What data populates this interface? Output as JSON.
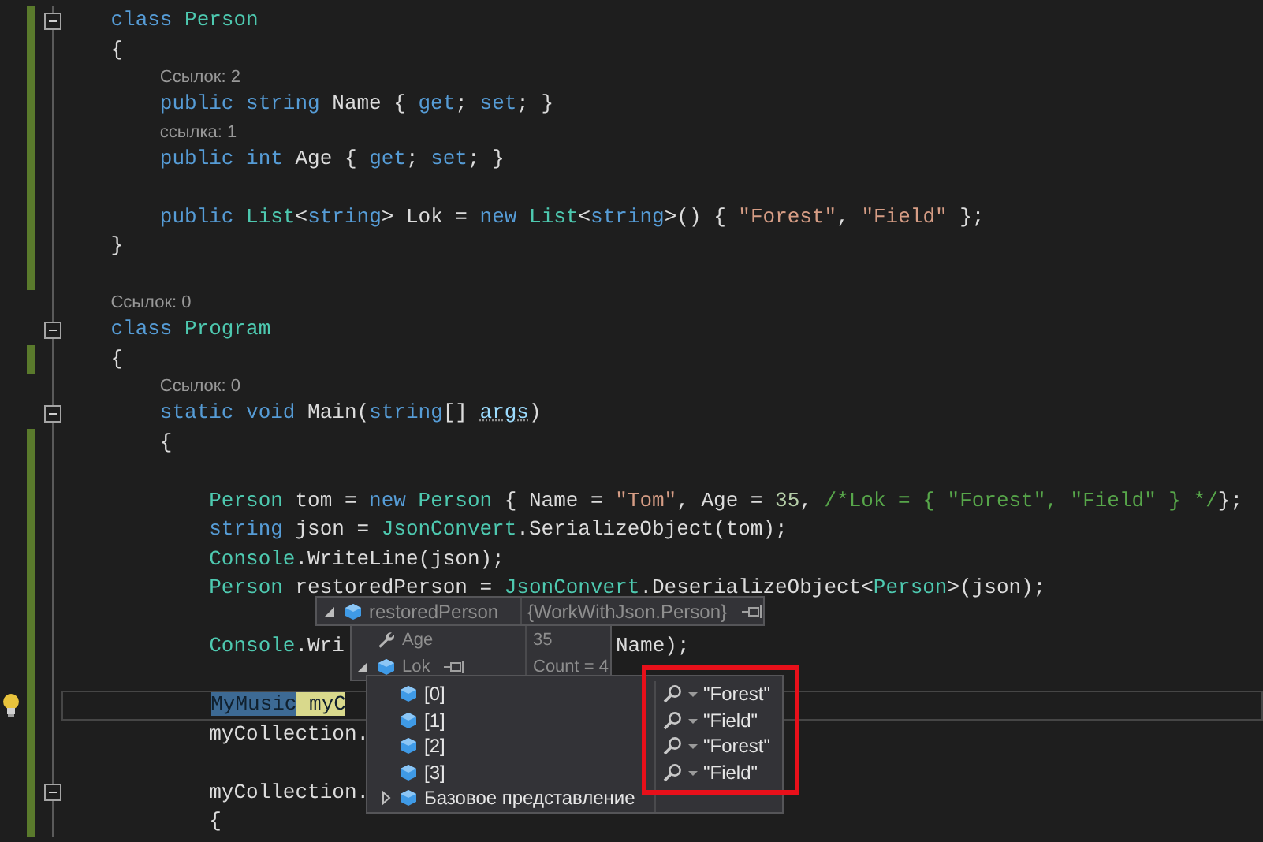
{
  "editor": {
    "lines": [
      {
        "kind": "code",
        "changed": true,
        "fold": true,
        "tokens": [
          {
            "kind": "keyword",
            "text": "    class "
          },
          {
            "kind": "type",
            "text": "Person"
          }
        ]
      },
      {
        "kind": "code",
        "changed": true,
        "fold": false,
        "tokens": [
          {
            "kind": "plain",
            "text": "    {"
          }
        ]
      },
      {
        "kind": "lens",
        "changed": true,
        "text": "Ссылок: 2"
      },
      {
        "kind": "code",
        "changed": true,
        "fold": false,
        "tokens": [
          {
            "kind": "keyword",
            "text": "        public string "
          },
          {
            "kind": "plain",
            "text": "Name { "
          },
          {
            "kind": "keyword",
            "text": "get"
          },
          {
            "kind": "plain",
            "text": "; "
          },
          {
            "kind": "keyword",
            "text": "set"
          },
          {
            "kind": "plain",
            "text": "; }"
          }
        ]
      },
      {
        "kind": "lens",
        "changed": true,
        "text": "ссылка: 1"
      },
      {
        "kind": "code",
        "changed": true,
        "fold": false,
        "tokens": [
          {
            "kind": "keyword",
            "text": "        public int "
          },
          {
            "kind": "plain",
            "text": "Age { "
          },
          {
            "kind": "keyword",
            "text": "get"
          },
          {
            "kind": "plain",
            "text": "; "
          },
          {
            "kind": "keyword",
            "text": "set"
          },
          {
            "kind": "plain",
            "text": "; }"
          }
        ]
      },
      {
        "kind": "code",
        "changed": true,
        "fold": false
      },
      {
        "kind": "code",
        "changed": true,
        "fold": false,
        "tokens": [
          {
            "kind": "keyword",
            "text": "        public "
          },
          {
            "kind": "type",
            "text": "List"
          },
          {
            "kind": "plain",
            "text": "<"
          },
          {
            "kind": "keyword",
            "text": "string"
          },
          {
            "kind": "plain",
            "text": "> Lok = "
          },
          {
            "kind": "keyword",
            "text": "new "
          },
          {
            "kind": "type",
            "text": "List"
          },
          {
            "kind": "plain",
            "text": "<"
          },
          {
            "kind": "keyword",
            "text": "string"
          },
          {
            "kind": "plain",
            "text": ">() { "
          },
          {
            "kind": "string",
            "text": "\"Forest\""
          },
          {
            "kind": "plain",
            "text": ", "
          },
          {
            "kind": "string",
            "text": "\"Field\""
          },
          {
            "kind": "plain",
            "text": " };"
          }
        ]
      },
      {
        "kind": "code",
        "changed": true,
        "fold": false,
        "tokens": [
          {
            "kind": "plain",
            "text": "    }"
          }
        ]
      },
      {
        "kind": "code",
        "changed": true,
        "fold": false
      },
      {
        "kind": "lens",
        "changed": false,
        "text": "Ссылок: 0"
      },
      {
        "kind": "code",
        "changed": false,
        "fold": true,
        "tokens": [
          {
            "kind": "keyword",
            "text": "    class "
          },
          {
            "kind": "type",
            "text": "Program"
          }
        ]
      },
      {
        "kind": "code",
        "changed": true,
        "fold": false,
        "tokens": [
          {
            "kind": "plain",
            "text": "    {"
          }
        ]
      },
      {
        "kind": "lens",
        "changed": false,
        "text": "Ссылок: 0"
      },
      {
        "kind": "code",
        "changed": false,
        "fold": true,
        "tokens": [
          {
            "kind": "keyword",
            "text": "        static void "
          },
          {
            "kind": "plain",
            "text": "Main("
          },
          {
            "kind": "keyword",
            "text": "string"
          },
          {
            "kind": "plain",
            "text": "[] "
          },
          {
            "kind": "unused",
            "text": "args"
          },
          {
            "kind": "plain",
            "text": ")"
          }
        ]
      },
      {
        "kind": "code",
        "changed": true,
        "fold": false,
        "tokens": [
          {
            "kind": "plain",
            "text": "        {"
          }
        ]
      },
      {
        "kind": "code",
        "changed": true,
        "fold": false
      },
      {
        "kind": "code",
        "changed": true,
        "fold": false,
        "tokens": [
          {
            "kind": "type",
            "text": "            Person "
          },
          {
            "kind": "plain",
            "text": "tom = "
          },
          {
            "kind": "keyword",
            "text": "new "
          },
          {
            "kind": "type",
            "text": "Person "
          },
          {
            "kind": "plain",
            "text": "{ Name = "
          },
          {
            "kind": "string",
            "text": "\"Tom\""
          },
          {
            "kind": "plain",
            "text": ", Age = "
          },
          {
            "kind": "number",
            "text": "35"
          },
          {
            "kind": "plain",
            "text": ", "
          },
          {
            "kind": "comment",
            "text": "/*Lok = { \"Forest\", \"Field\" } */"
          },
          {
            "kind": "plain",
            "text": "};"
          }
        ]
      },
      {
        "kind": "code",
        "changed": true,
        "fold": false,
        "tokens": [
          {
            "kind": "keyword",
            "text": "            string "
          },
          {
            "kind": "plain",
            "text": "json = "
          },
          {
            "kind": "type",
            "text": "JsonConvert"
          },
          {
            "kind": "plain",
            "text": ".SerializeObject(tom);"
          }
        ]
      },
      {
        "kind": "code",
        "changed": true,
        "fold": false,
        "tokens": [
          {
            "kind": "type",
            "text": "            Console"
          },
          {
            "kind": "plain",
            "text": ".WriteLine(json);"
          }
        ]
      },
      {
        "kind": "code",
        "changed": true,
        "fold": false,
        "tokens": [
          {
            "kind": "type",
            "text": "            Person "
          },
          {
            "kind": "plain",
            "text": "restoredPerson = "
          },
          {
            "kind": "type",
            "text": "JsonConvert"
          },
          {
            "kind": "plain",
            "text": ".DeserializeObject<"
          },
          {
            "kind": "type",
            "text": "Person"
          },
          {
            "kind": "plain",
            "text": ">(json);"
          }
        ]
      },
      {
        "kind": "code",
        "changed": true,
        "fold": false
      },
      {
        "kind": "code",
        "changed": true,
        "fold": false,
        "tokens": [
          {
            "kind": "type",
            "text": "            Console"
          },
          {
            "kind": "plain",
            "text": ".Wri"
          },
          {
            "kind": "plain",
            "text": "Name);",
            "gap": true
          }
        ]
      },
      {
        "kind": "code",
        "changed": true,
        "fold": false
      },
      {
        "kind": "code",
        "changed": true,
        "fold": false,
        "current": true,
        "lightbulb": true,
        "tokens": [
          {
            "kind": "type",
            "text": "            MyMusic",
            "color": "#3d6a94"
          },
          {
            "kind": "plain",
            "text": " myC",
            "color": "#d9d98c"
          }
        ]
      },
      {
        "kind": "code",
        "changed": true,
        "fold": false,
        "tokens": [
          {
            "kind": "plain",
            "text": "            myCollection."
          }
        ]
      },
      {
        "kind": "code",
        "changed": true,
        "fold": false
      },
      {
        "kind": "code",
        "changed": true,
        "fold": true,
        "tokens": [
          {
            "kind": "plain",
            "text": "            myCollection."
          }
        ]
      },
      {
        "kind": "code",
        "changed": true,
        "fold": false,
        "tokens": [
          {
            "kind": "plain",
            "text": "            {"
          }
        ]
      }
    ]
  },
  "datatip": {
    "kind": "field",
    "name": "restoredPerson",
    "value": "{WorkWithJson.Person}",
    "expanded": true,
    "pin": true,
    "members": [
      {
        "kind": "property",
        "name": "Age",
        "value": "35",
        "pin": false
      },
      {
        "kind": "field",
        "name": "Lok",
        "value": "Count = 4",
        "expanded": true,
        "pin": true,
        "items": [
          {
            "kind": "field",
            "name": "[0]",
            "value": "\"Forest\"",
            "visualizer": true
          },
          {
            "kind": "field",
            "name": "[1]",
            "value": "\"Field\"",
            "visualizer": true
          },
          {
            "kind": "field",
            "name": "[2]",
            "value": "\"Forest\"",
            "visualizer": true
          },
          {
            "kind": "field",
            "name": "[3]",
            "value": "\"Field\"",
            "visualizer": true
          },
          {
            "kind": "field",
            "name": "Базовое представление",
            "expanded": false
          }
        ]
      }
    ]
  }
}
